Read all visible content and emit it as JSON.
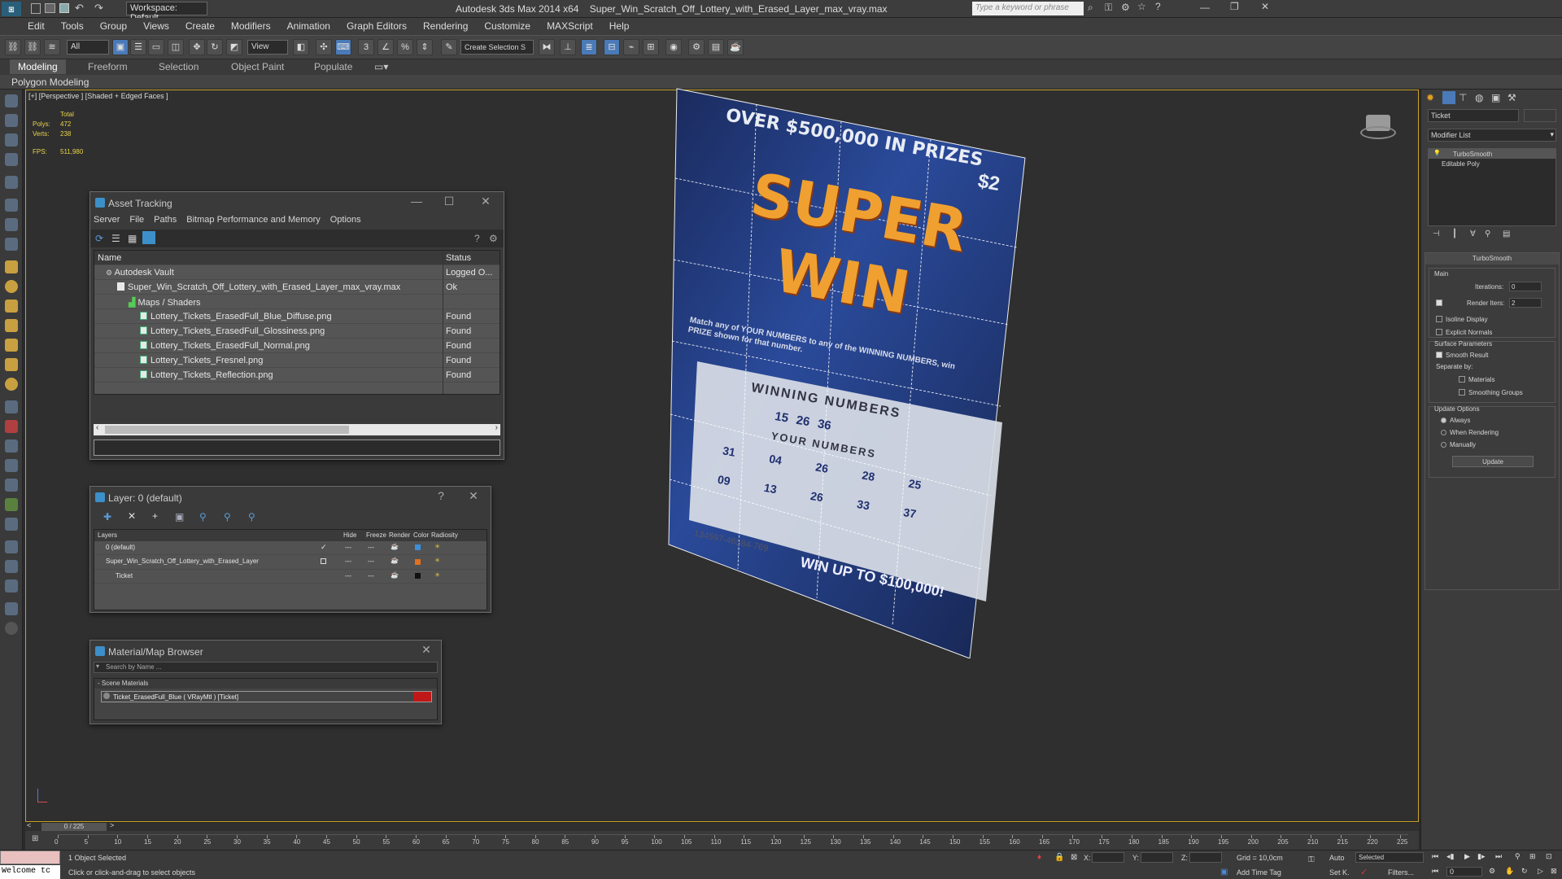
{
  "app": {
    "title": "Autodesk 3ds Max  2014 x64",
    "filename": "Super_Win_Scratch_Off_Lottery_with_Erased_Layer_max_vray.max",
    "workspace": "Workspace: Default",
    "search_placeholder": "Type a keyword or phrase"
  },
  "menu": [
    "Edit",
    "Tools",
    "Group",
    "Views",
    "Create",
    "Modifiers",
    "Animation",
    "Graph Editors",
    "Rendering",
    "Customize",
    "MAXScript",
    "Help"
  ],
  "toolbar": {
    "selection_filter": "All",
    "ref_coord": "View",
    "named_selection": "Create Selection S"
  },
  "ribbon": {
    "tabs": [
      "Modeling",
      "Freeform",
      "Selection",
      "Object Paint",
      "Populate"
    ],
    "active_tab": "Modeling",
    "sub": "Polygon Modeling"
  },
  "viewport": {
    "label": "[+] [Perspective ] [Shaded + Edged Faces ]",
    "stats": {
      "total_label": "Total",
      "polys_label": "Polys:",
      "polys": "472",
      "verts_label": "Verts:",
      "verts": "238",
      "fps_label": "FPS:",
      "fps": "511,980"
    },
    "ticket": {
      "headline": "OVER $500,000 IN PRIZES",
      "price": "$2",
      "title1": "SUPER",
      "title2": "WIN",
      "instructions": "Match any of YOUR NUMBERS to any of the WINNING NUMBERS, win PRIZE shown for that number.",
      "winning_label": "WINNING NUMBERS",
      "winning_numbers": [
        "15",
        "26",
        "36"
      ],
      "your_label": "YOUR NUMBERS",
      "your_numbers": [
        "31",
        "04",
        "26",
        "28",
        "25",
        "09",
        "13",
        "26",
        "33",
        "37"
      ],
      "serial": "134597-46584-769",
      "footer": "WIN UP TO $100,000!"
    }
  },
  "asset_tracking": {
    "title": "Asset Tracking",
    "menu": [
      "Server",
      "File",
      "Paths",
      "Bitmap Performance and Memory",
      "Options"
    ],
    "columns": [
      "Name",
      "Status"
    ],
    "rows": [
      {
        "name": "Autodesk Vault",
        "status": "Logged O..."
      },
      {
        "name": "Super_Win_Scratch_Off_Lottery_with_Erased_Layer_max_vray.max",
        "status": "Ok"
      },
      {
        "name": "Maps / Shaders",
        "status": ""
      },
      {
        "name": "Lottery_Tickets_ErasedFull_Blue_Diffuse.png",
        "status": "Found"
      },
      {
        "name": "Lottery_Tickets_ErasedFull_Glossiness.png",
        "status": "Found"
      },
      {
        "name": "Lottery_Tickets_ErasedFull_Normal.png",
        "status": "Found"
      },
      {
        "name": "Lottery_Tickets_Fresnel.png",
        "status": "Found"
      },
      {
        "name": "Lottery_Tickets_Reflection.png",
        "status": "Found"
      }
    ]
  },
  "layer": {
    "title": "Layer: 0 (default)",
    "columns": [
      "Layers",
      "Hide",
      "Freeze",
      "Render",
      "Color",
      "Radiosity"
    ],
    "rows": [
      {
        "name": "0 (default)",
        "color": "#3c8fd8"
      },
      {
        "name": "Super_Win_Scratch_Off_Lottery_with_Erased_Layer",
        "color": "#e07020"
      },
      {
        "name": "Ticket",
        "color": "#111111"
      }
    ]
  },
  "material_browser": {
    "title": "Material/Map Browser",
    "search_placeholder": "Search by Name ...",
    "section": "- Scene Materials",
    "item": "Ticket_ErasedFull_Blue ( VRayMtl ) [Ticket]"
  },
  "command_panel": {
    "object_name": "Ticket",
    "modifier_list": "Modifier List",
    "stack": [
      "TurboSmooth",
      "Editable Poly"
    ],
    "rollout_title": "TurboSmooth",
    "main_label": "Main",
    "iterations_label": "Iterations:",
    "iterations": "0",
    "render_iters_label": "Render Iters:",
    "render_iters": "2",
    "isoline": "Isoline Display",
    "explicit": "Explicit Normals",
    "surface_label": "Surface Parameters",
    "smooth_result": "Smooth Result",
    "separate_by": "Separate by:",
    "materials": "Materials",
    "smoothing_groups": "Smoothing Groups",
    "update_options": "Update Options",
    "always": "Always",
    "when_rendering": "When Rendering",
    "manually": "Manually",
    "update_btn": "Update"
  },
  "timeline": {
    "frame": "0 / 225",
    "ticks": [
      "0",
      "5",
      "10",
      "15",
      "20",
      "25",
      "30",
      "35",
      "40",
      "45",
      "50",
      "55",
      "60",
      "65",
      "70",
      "75",
      "80",
      "85",
      "90",
      "95",
      "100",
      "105",
      "110",
      "115",
      "120",
      "125",
      "130",
      "135",
      "140",
      "145",
      "150",
      "155",
      "160",
      "165",
      "170",
      "175",
      "180",
      "185",
      "190",
      "195",
      "200",
      "205",
      "210",
      "215",
      "220",
      "225"
    ]
  },
  "status": {
    "welcome": "Welcome tc",
    "selected": "1 Object Selected",
    "hint": "Click or click-and-drag to select objects",
    "x_label": "X:",
    "y_label": "Y:",
    "z_label": "Z:",
    "grid": "Grid = 10,0cm",
    "add_time_tag": "Add Time Tag",
    "auto": "Auto",
    "set_key": "Set K.",
    "key_mode": "Selected",
    "filters": "Filters...",
    "frame_field": "0"
  }
}
